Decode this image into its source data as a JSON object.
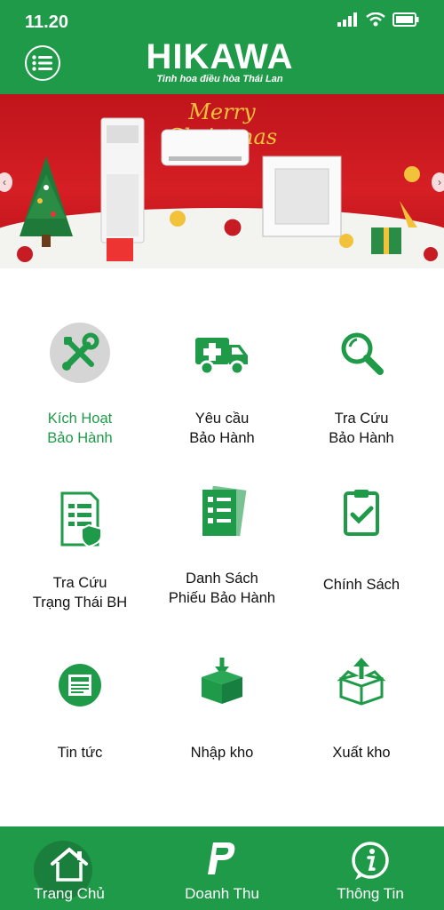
{
  "status_bar": {
    "time": "11.20"
  },
  "header": {
    "logo_text": "HIKAWA",
    "tagline": "Tinh hoa điều hòa Thái Lan"
  },
  "banner": {
    "title": "Merry Christmas"
  },
  "menu_tiles": [
    {
      "line1": "Kích Hoạt",
      "line2": "Bảo Hành",
      "icon": "tools-icon",
      "active": true
    },
    {
      "line1": "Yêu cầu",
      "line2": "Bảo Hành",
      "icon": "ambulance-icon",
      "active": false
    },
    {
      "line1": "Tra Cứu",
      "line2": "Bảo Hành",
      "icon": "search-icon",
      "active": false
    },
    {
      "line1": "Tra Cứu",
      "line2": "Trạng Thái BH",
      "icon": "document-shield-icon",
      "active": false
    },
    {
      "line1": "Danh Sách",
      "line2": "Phiếu Bảo Hành",
      "icon": "checklist-icon",
      "active": false
    },
    {
      "line1": "Chính Sách",
      "line2": "",
      "icon": "clipboard-check-icon",
      "active": false
    },
    {
      "line1": "Tin tức",
      "line2": "",
      "icon": "news-icon",
      "active": false
    },
    {
      "line1": "Nhập kho",
      "line2": "",
      "icon": "box-import-icon",
      "active": false
    },
    {
      "line1": "Xuất kho",
      "line2": "",
      "icon": "box-export-icon",
      "active": false
    }
  ],
  "bottom_nav": [
    {
      "label": "Trang Chủ",
      "icon": "home-icon",
      "active": true
    },
    {
      "label": "Doanh Thu",
      "icon": "paypal-icon",
      "active": false
    },
    {
      "label": "Thông Tin",
      "icon": "info-icon",
      "active": false
    }
  ],
  "colors": {
    "brand_green": "#1f9a48",
    "banner_red": "#d51f24",
    "text_dark": "#111111"
  }
}
